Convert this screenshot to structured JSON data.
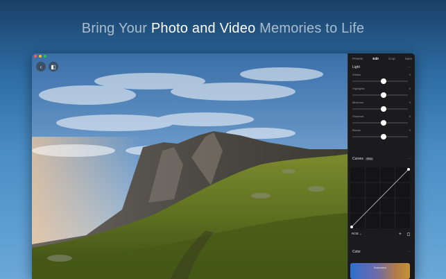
{
  "headline": {
    "part1": "Bring Your ",
    "part2": "Photo and Video",
    "part3": " Memories to Life"
  },
  "panel": {
    "tabs": [
      {
        "label": "Presets"
      },
      {
        "label": "Edit",
        "active": true
      },
      {
        "label": "Crop"
      },
      {
        "label": "Save"
      }
    ],
    "light": {
      "title": "Light",
      "more": "···",
      "sliders": [
        {
          "label": "Whites",
          "value": "0",
          "level": 0.5
        },
        {
          "label": "Highlights",
          "value": "0",
          "level": 0.5
        },
        {
          "label": "Midtones",
          "value": "0",
          "level": 0.5
        },
        {
          "label": "Shadows",
          "value": "0",
          "level": 0.5
        },
        {
          "label": "Blacks",
          "value": "0",
          "level": 0.5
        }
      ]
    },
    "curves": {
      "title": "Curves",
      "badge": "PRO",
      "more": "···",
      "channel": "RGB",
      "chevron": "⌄",
      "add": "+"
    },
    "color": {
      "title": "Color",
      "more": "···",
      "saturation_label": "Saturation"
    }
  },
  "colors": {
    "traffic_red": "#ff5f57",
    "traffic_yellow": "#febc2e",
    "traffic_green": "#28c840"
  },
  "icons": {
    "back": "chevron-left-icon",
    "compare": "compare-icon",
    "delete": "trash-icon"
  }
}
